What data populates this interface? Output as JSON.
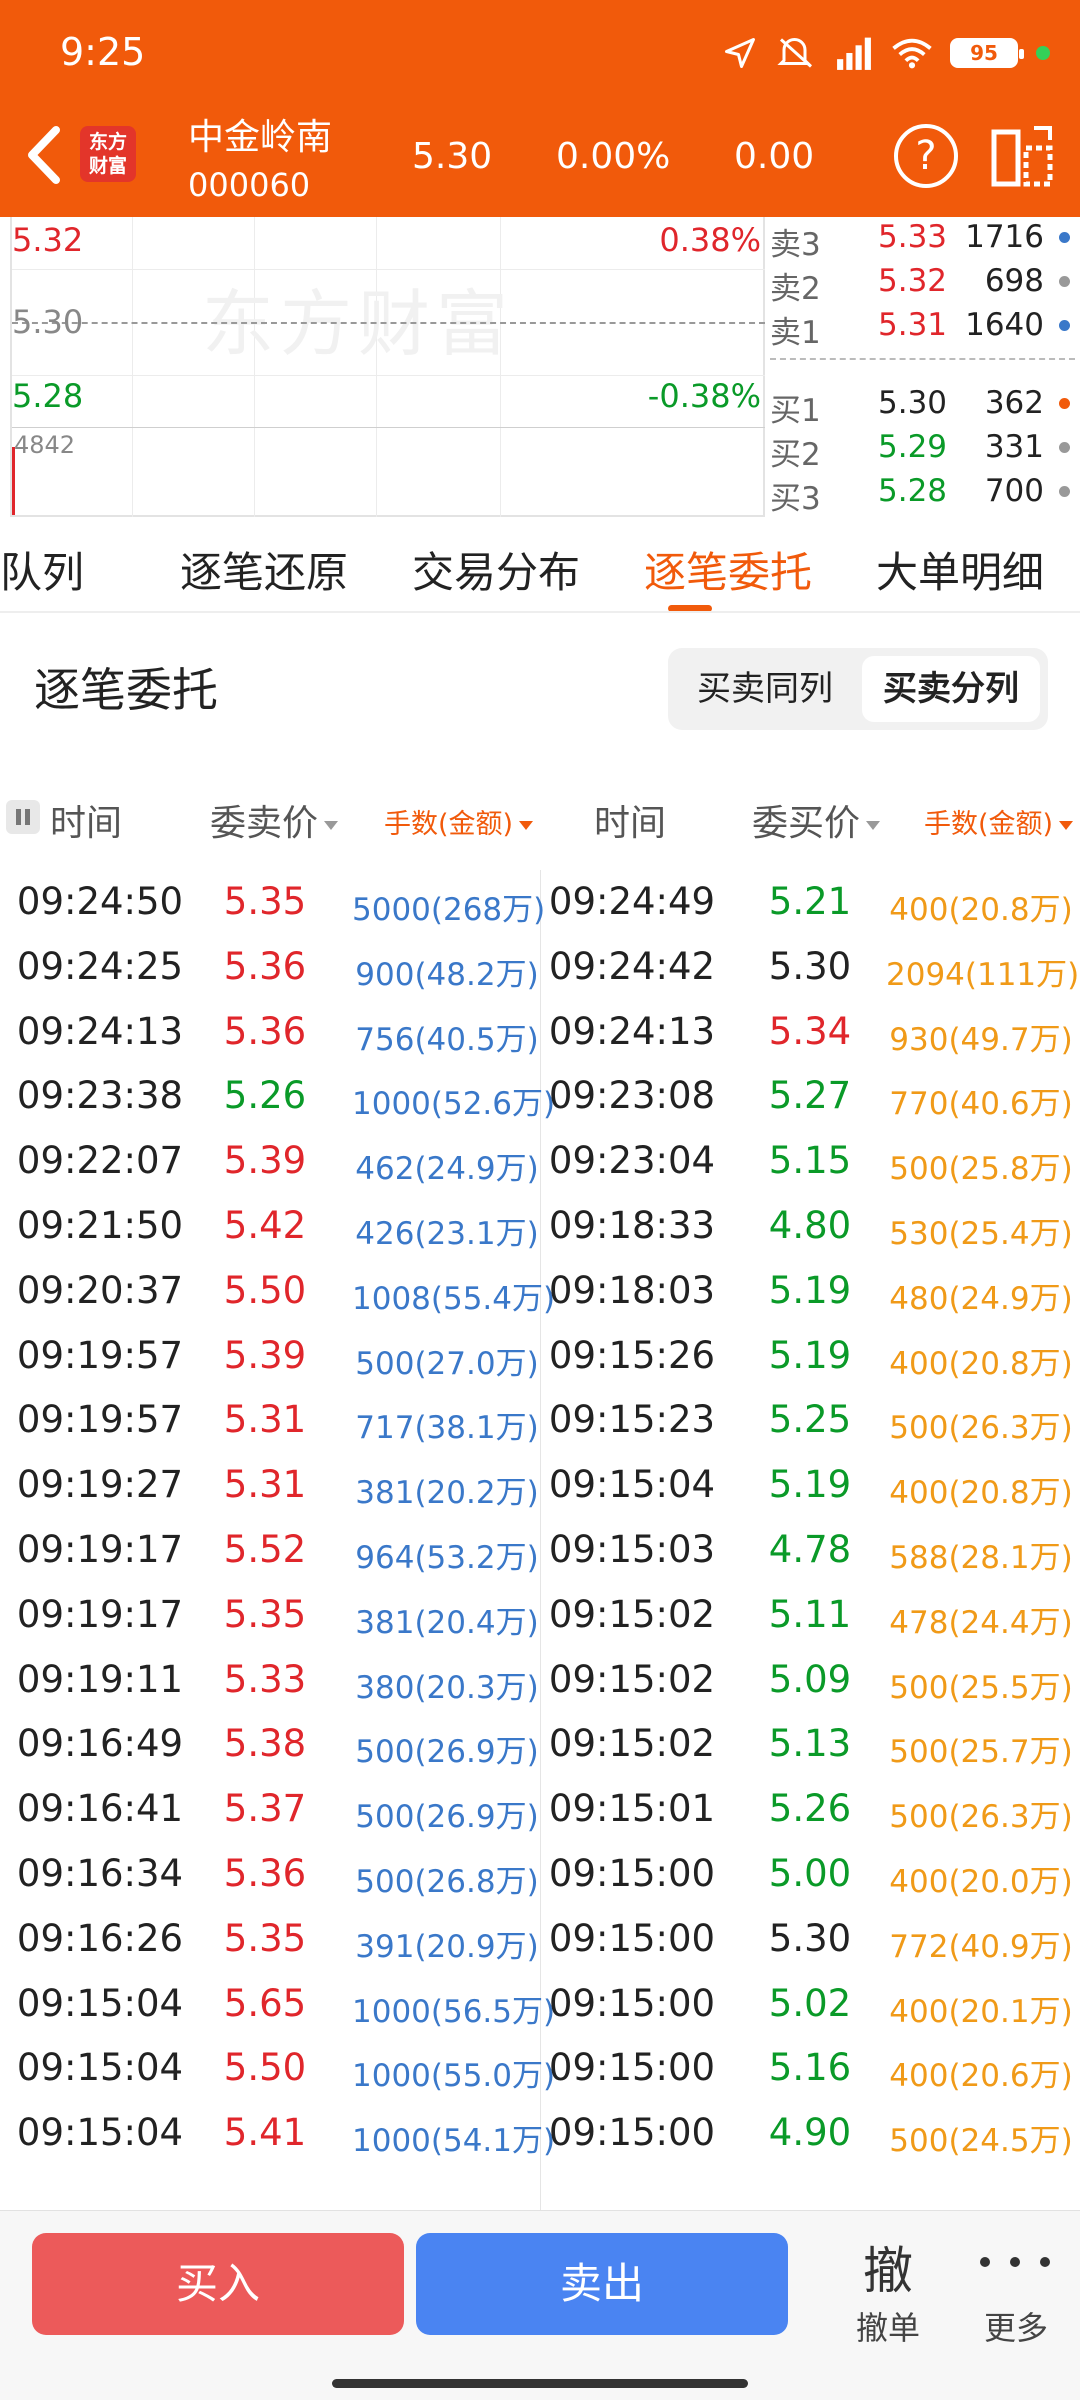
{
  "status_bar": {
    "time": "9:25",
    "battery": "95"
  },
  "header": {
    "logo_text": "东方财富",
    "stock_name": "中金岭南",
    "stock_code": "000060",
    "price": "5.30",
    "change_pct": "0.00%",
    "change": "0.00",
    "help_label": "?"
  },
  "chart": {
    "watermark": "东方财富",
    "top_price": "5.32",
    "top_pct": "0.38%",
    "mid_price": "5.30",
    "bottom_price": "5.28",
    "bottom_pct": "-0.38%",
    "volume": "4842"
  },
  "orderbook": {
    "asks": [
      {
        "label": "卖3",
        "price": "5.33",
        "vol": "1716",
        "dot_color": "#3a78c9"
      },
      {
        "label": "卖2",
        "price": "5.32",
        "vol": "698",
        "dot_color": "#999999"
      },
      {
        "label": "卖1",
        "price": "5.31",
        "vol": "1640",
        "dot_color": "#3a78c9"
      }
    ],
    "bids": [
      {
        "label": "买1",
        "price": "5.30",
        "vol": "362",
        "dot_color": "#f15a0b"
      },
      {
        "label": "买2",
        "price": "5.29",
        "vol": "331",
        "dot_color": "#999999"
      },
      {
        "label": "买3",
        "price": "5.28",
        "vol": "700",
        "dot_color": "#999999"
      }
    ]
  },
  "tabs": [
    {
      "label": "卖队列"
    },
    {
      "label": "逐笔还原"
    },
    {
      "label": "交易分布"
    },
    {
      "label": "逐笔委托"
    },
    {
      "label": "大单明细"
    }
  ],
  "section": {
    "title": "逐笔委托",
    "toggle_same": "买卖同列",
    "toggle_split": "买卖分列"
  },
  "table_header": {
    "time": "时间",
    "ask_price": "委卖价",
    "ask_lots": "手数(金额)",
    "time2": "时间",
    "bid_price": "委买价",
    "bid_lots": "手数(金额)"
  },
  "rows": [
    {
      "st": "09:24:50",
      "sp": "5.35",
      "spc": "red",
      "sv": "5000(268万)",
      "bt": "09:24:49",
      "bp": "5.21",
      "bpc": "green",
      "bv": "400(20.8万)"
    },
    {
      "st": "09:24:25",
      "sp": "5.36",
      "spc": "red",
      "sv": "900(48.2万)",
      "bt": "09:24:42",
      "bp": "5.30",
      "bpc": "black",
      "bv": "2094(111万)"
    },
    {
      "st": "09:24:13",
      "sp": "5.36",
      "spc": "red",
      "sv": "756(40.5万)",
      "bt": "09:24:13",
      "bp": "5.34",
      "bpc": "red",
      "bv": "930(49.7万)"
    },
    {
      "st": "09:23:38",
      "sp": "5.26",
      "spc": "green",
      "sv": "1000(52.6万)",
      "bt": "09:23:08",
      "bp": "5.27",
      "bpc": "green",
      "bv": "770(40.6万)"
    },
    {
      "st": "09:22:07",
      "sp": "5.39",
      "spc": "red",
      "sv": "462(24.9万)",
      "bt": "09:23:04",
      "bp": "5.15",
      "bpc": "green",
      "bv": "500(25.8万)"
    },
    {
      "st": "09:21:50",
      "sp": "5.42",
      "spc": "red",
      "sv": "426(23.1万)",
      "bt": "09:18:33",
      "bp": "4.80",
      "bpc": "green",
      "bv": "530(25.4万)"
    },
    {
      "st": "09:20:37",
      "sp": "5.50",
      "spc": "red",
      "sv": "1008(55.4万)",
      "bt": "09:18:03",
      "bp": "5.19",
      "bpc": "green",
      "bv": "480(24.9万)"
    },
    {
      "st": "09:19:57",
      "sp": "5.39",
      "spc": "red",
      "sv": "500(27.0万)",
      "bt": "09:15:26",
      "bp": "5.19",
      "bpc": "green",
      "bv": "400(20.8万)"
    },
    {
      "st": "09:19:57",
      "sp": "5.31",
      "spc": "red",
      "sv": "717(38.1万)",
      "bt": "09:15:23",
      "bp": "5.25",
      "bpc": "green",
      "bv": "500(26.3万)"
    },
    {
      "st": "09:19:27",
      "sp": "5.31",
      "spc": "red",
      "sv": "381(20.2万)",
      "bt": "09:15:04",
      "bp": "5.19",
      "bpc": "green",
      "bv": "400(20.8万)"
    },
    {
      "st": "09:19:17",
      "sp": "5.52",
      "spc": "red",
      "sv": "964(53.2万)",
      "bt": "09:15:03",
      "bp": "4.78",
      "bpc": "green",
      "bv": "588(28.1万)"
    },
    {
      "st": "09:19:17",
      "sp": "5.35",
      "spc": "red",
      "sv": "381(20.4万)",
      "bt": "09:15:02",
      "bp": "5.11",
      "bpc": "green",
      "bv": "478(24.4万)"
    },
    {
      "st": "09:19:11",
      "sp": "5.33",
      "spc": "red",
      "sv": "380(20.3万)",
      "bt": "09:15:02",
      "bp": "5.09",
      "bpc": "green",
      "bv": "500(25.5万)"
    },
    {
      "st": "09:16:49",
      "sp": "5.38",
      "spc": "red",
      "sv": "500(26.9万)",
      "bt": "09:15:02",
      "bp": "5.13",
      "bpc": "green",
      "bv": "500(25.7万)"
    },
    {
      "st": "09:16:41",
      "sp": "5.37",
      "spc": "red",
      "sv": "500(26.9万)",
      "bt": "09:15:01",
      "bp": "5.26",
      "bpc": "green",
      "bv": "500(26.3万)"
    },
    {
      "st": "09:16:34",
      "sp": "5.36",
      "spc": "red",
      "sv": "500(26.8万)",
      "bt": "09:15:00",
      "bp": "5.00",
      "bpc": "green",
      "bv": "400(20.0万)"
    },
    {
      "st": "09:16:26",
      "sp": "5.35",
      "spc": "red",
      "sv": "391(20.9万)",
      "bt": "09:15:00",
      "bp": "5.30",
      "bpc": "black",
      "bv": "772(40.9万)"
    },
    {
      "st": "09:15:04",
      "sp": "5.65",
      "spc": "red",
      "sv": "1000(56.5万)",
      "bt": "09:15:00",
      "bp": "5.02",
      "bpc": "green",
      "bv": "400(20.1万)"
    },
    {
      "st": "09:15:04",
      "sp": "5.50",
      "spc": "red",
      "sv": "1000(55.0万)",
      "bt": "09:15:00",
      "bp": "5.16",
      "bpc": "green",
      "bv": "400(20.6万)"
    },
    {
      "st": "09:15:04",
      "sp": "5.41",
      "spc": "red",
      "sv": "1000(54.1万)",
      "bt": "09:15:00",
      "bp": "4.90",
      "bpc": "green",
      "bv": "500(24.5万)"
    }
  ],
  "bottom": {
    "buy": "买入",
    "sell": "卖出",
    "cancel_icon": "撤",
    "cancel": "撤单",
    "more": "更多"
  },
  "colors": {
    "brand": "#f15a0b",
    "up": "#e0262b",
    "down": "#0a9a28",
    "buy_button": "#ec5a5a",
    "sell_button": "#4a84f2"
  }
}
